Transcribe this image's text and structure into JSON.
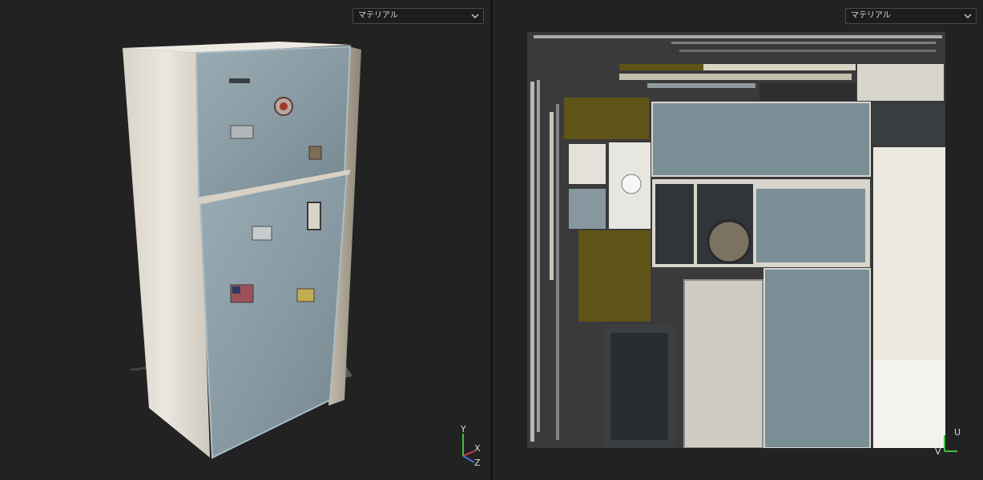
{
  "left_viewport": {
    "material_dropdown": {
      "selected": "マテリアル"
    },
    "axis_gizmo": {
      "y": "Y",
      "x": "X",
      "z": "Z"
    }
  },
  "right_viewport": {
    "material_dropdown": {
      "selected": "マテリアル"
    },
    "axis_gizmo": {
      "u": "U",
      "v": "V"
    }
  },
  "colors": {
    "background": "#222222",
    "fridge_body": "#e3ddd4",
    "fridge_door": "#8b9ea6",
    "texture_yellow": "#5f5418"
  }
}
